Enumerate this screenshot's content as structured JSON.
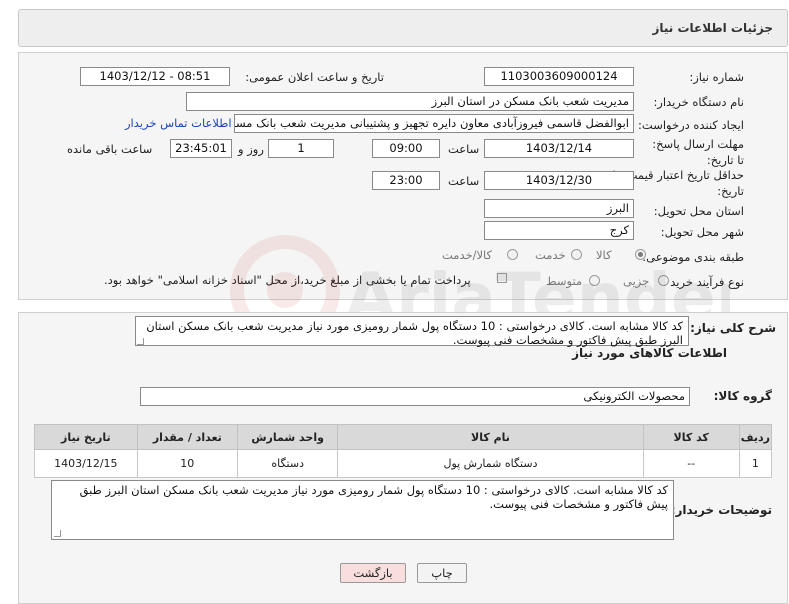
{
  "header": {
    "title": "جزئیات اطلاعات نیاز"
  },
  "form": {
    "need_number_label": "شماره نیاز:",
    "need_number": "1103003609000124",
    "announce_datetime_label": "تاریخ و ساعت اعلان عمومی:",
    "announce_datetime": "1403/12/12 - 08:51",
    "buyer_org_label": "نام دستگاه خریدار:",
    "buyer_org": "مدیریت شعب بانک مسکن در استان البرز",
    "creator_label": "ایجاد کننده درخواست:",
    "creator": "ابوالفضل قاسمی فیروزآبادی معاون دایره تجهیز و پشتیبانی مدیریت شعب بانک مسکن در استان البرز",
    "buyer_contact_link": "اطلاعات تماس خریدار",
    "reply_deadline_label": "مهلت ارسال پاسخ: تا تاریخ:",
    "reply_deadline_date": "1403/12/14",
    "time_label": "ساعت",
    "reply_deadline_time": "09:00",
    "days_value": "1",
    "days_label": "روز و",
    "remaining_time": "23:45:01",
    "remaining_label": "ساعت باقی مانده",
    "price_validity_label": "حداقل تاریخ اعتبار قیمت: تا تاریخ:",
    "price_validity_date": "1403/12/30",
    "price_validity_time": "23:00",
    "province_label": "استان محل تحویل:",
    "province": "البرز",
    "city_label": "شهر محل تحویل:",
    "city": "کرج",
    "category_label": "طبقه بندی موضوعی:",
    "category_options": [
      "کالا",
      "خدمت",
      "کالا/خدمت"
    ],
    "process_label": "نوع فرآیند خرید :",
    "process_options": [
      "جزیی",
      "متوسط"
    ],
    "payment_note": "پرداخت تمام یا بخشی از مبلغ خرید،از محل \"اسناد خزانه اسلامی\" خواهد بود."
  },
  "description": {
    "general_label": "شرح کلی نیاز:",
    "general_text": "کد کالا مشابه است. کالای درخواستی : 10 دستگاه پول شمار رومیزی مورد نیاز مدیریت شعب بانک مسکن استان البرز طبق پیش فاکتور و مشخصات فنی پیوست.",
    "goods_info_title": "اطلاعات کالاهای مورد نیاز",
    "goods_group_label": "گروه کالا:",
    "goods_group": "محصولات الکترونیکی",
    "table": {
      "headers": [
        "ردیف",
        "کد کالا",
        "نام کالا",
        "واحد شمارش",
        "تعداد / مقدار",
        "تاریخ نیاز"
      ],
      "rows": [
        [
          "1",
          "--",
          "دستگاه شمارش پول",
          "دستگاه",
          "10",
          "1403/12/15"
        ]
      ]
    },
    "buyer_notes_label": "توضیحات خریدار:",
    "buyer_notes_text": "کد کالا مشابه است. کالای درخواستی : 10 دستگاه پول شمار رومیزی مورد نیاز مدیریت شعب بانک مسکن استان البرز طبق پیش فاکتور و مشخصات فنی پیوست."
  },
  "buttons": {
    "print": "چاپ",
    "back": "بازگشت"
  },
  "watermark_text": "AriaTender.net",
  "colors": {
    "link": "#1a44b8",
    "back_button_bg": "#f9dede",
    "header_bg": "#eeeeee"
  }
}
